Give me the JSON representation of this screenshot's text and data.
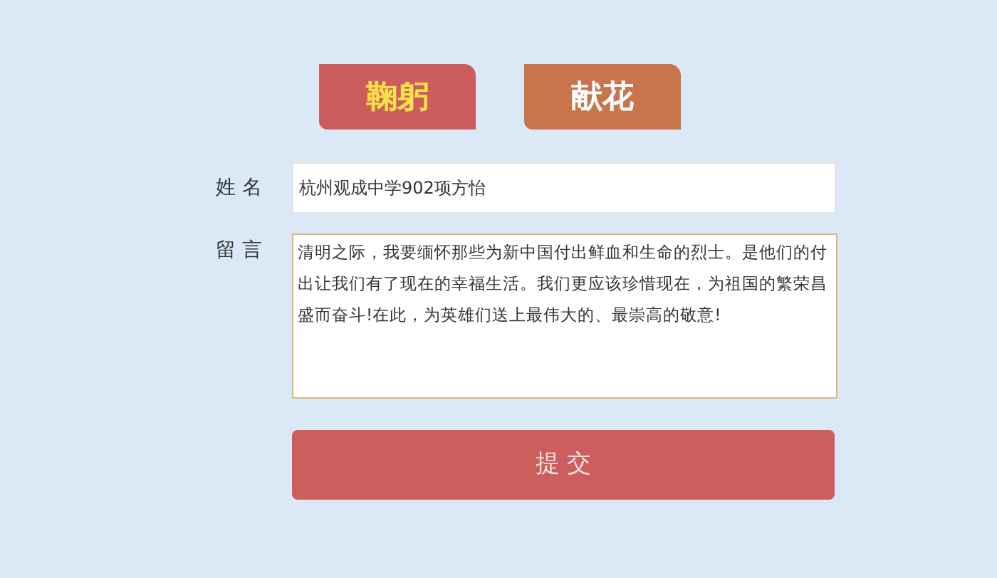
{
  "tabs": [
    {
      "label": "鞠躬",
      "selected": true
    },
    {
      "label": "献花",
      "selected": false
    }
  ],
  "form": {
    "name_label": "姓 名",
    "name_value": "杭州观成中学902项方怡",
    "message_label": "留 言",
    "message_value": "清明之际，我要缅怀那些为新中国付出鲜血和生命的烈士。是他们的付出让我们有了现在的幸福生活。我们更应该珍惜现在，为祖国的繁荣昌盛而奋斗!在此，为英雄们送上最伟大的、最崇高的敬意!"
  },
  "submit_button": "提 交"
}
